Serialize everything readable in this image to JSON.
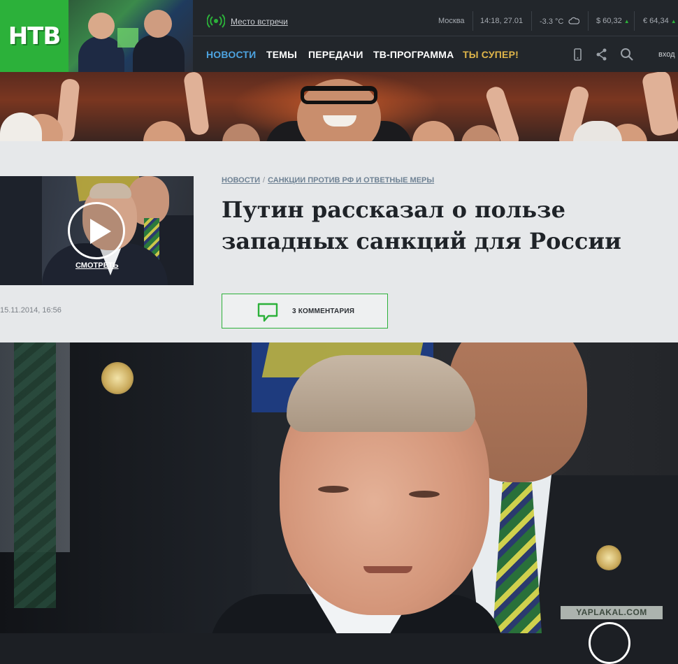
{
  "header": {
    "logo_text": "НТВ",
    "meet_link": "Место встречи",
    "city": "Москва",
    "datetime": "14:18, 27.01",
    "temperature": "-3.3 °C",
    "usd": "$ 60,32",
    "eur": "€ 64,34",
    "weather_icon": "cloud-icon",
    "radio_icon": "live-broadcast-icon"
  },
  "nav": {
    "items": [
      "НОВОСТИ",
      "ТЕМЫ",
      "ПЕРЕДАЧИ",
      "ТВ-ПРОГРАММА",
      "ТЫ СУПЕР!"
    ],
    "login": "вход",
    "icons": [
      "mobile-icon",
      "share-icon",
      "search-icon"
    ]
  },
  "article": {
    "breadcrumb": [
      "НОВОСТИ",
      "САНКЦИИ ПРОТИВ РФ И ОТВЕТНЫЕ МЕРЫ"
    ],
    "title": "Путин рассказал о пользе западных санкций для России",
    "watch_label": "СМОТРЕТЬ",
    "date": "15.11.2014, 16:56",
    "comments": "3 КОММЕНТАРИЯ"
  },
  "watermark": "YAPLAKAL.COM",
  "colors": {
    "brand_green": "#2cb13a",
    "nav_active": "#4da3e0",
    "nav_gold": "#e0b64a",
    "header_bg": "#22262b",
    "article_bg": "#e6e8ea"
  }
}
